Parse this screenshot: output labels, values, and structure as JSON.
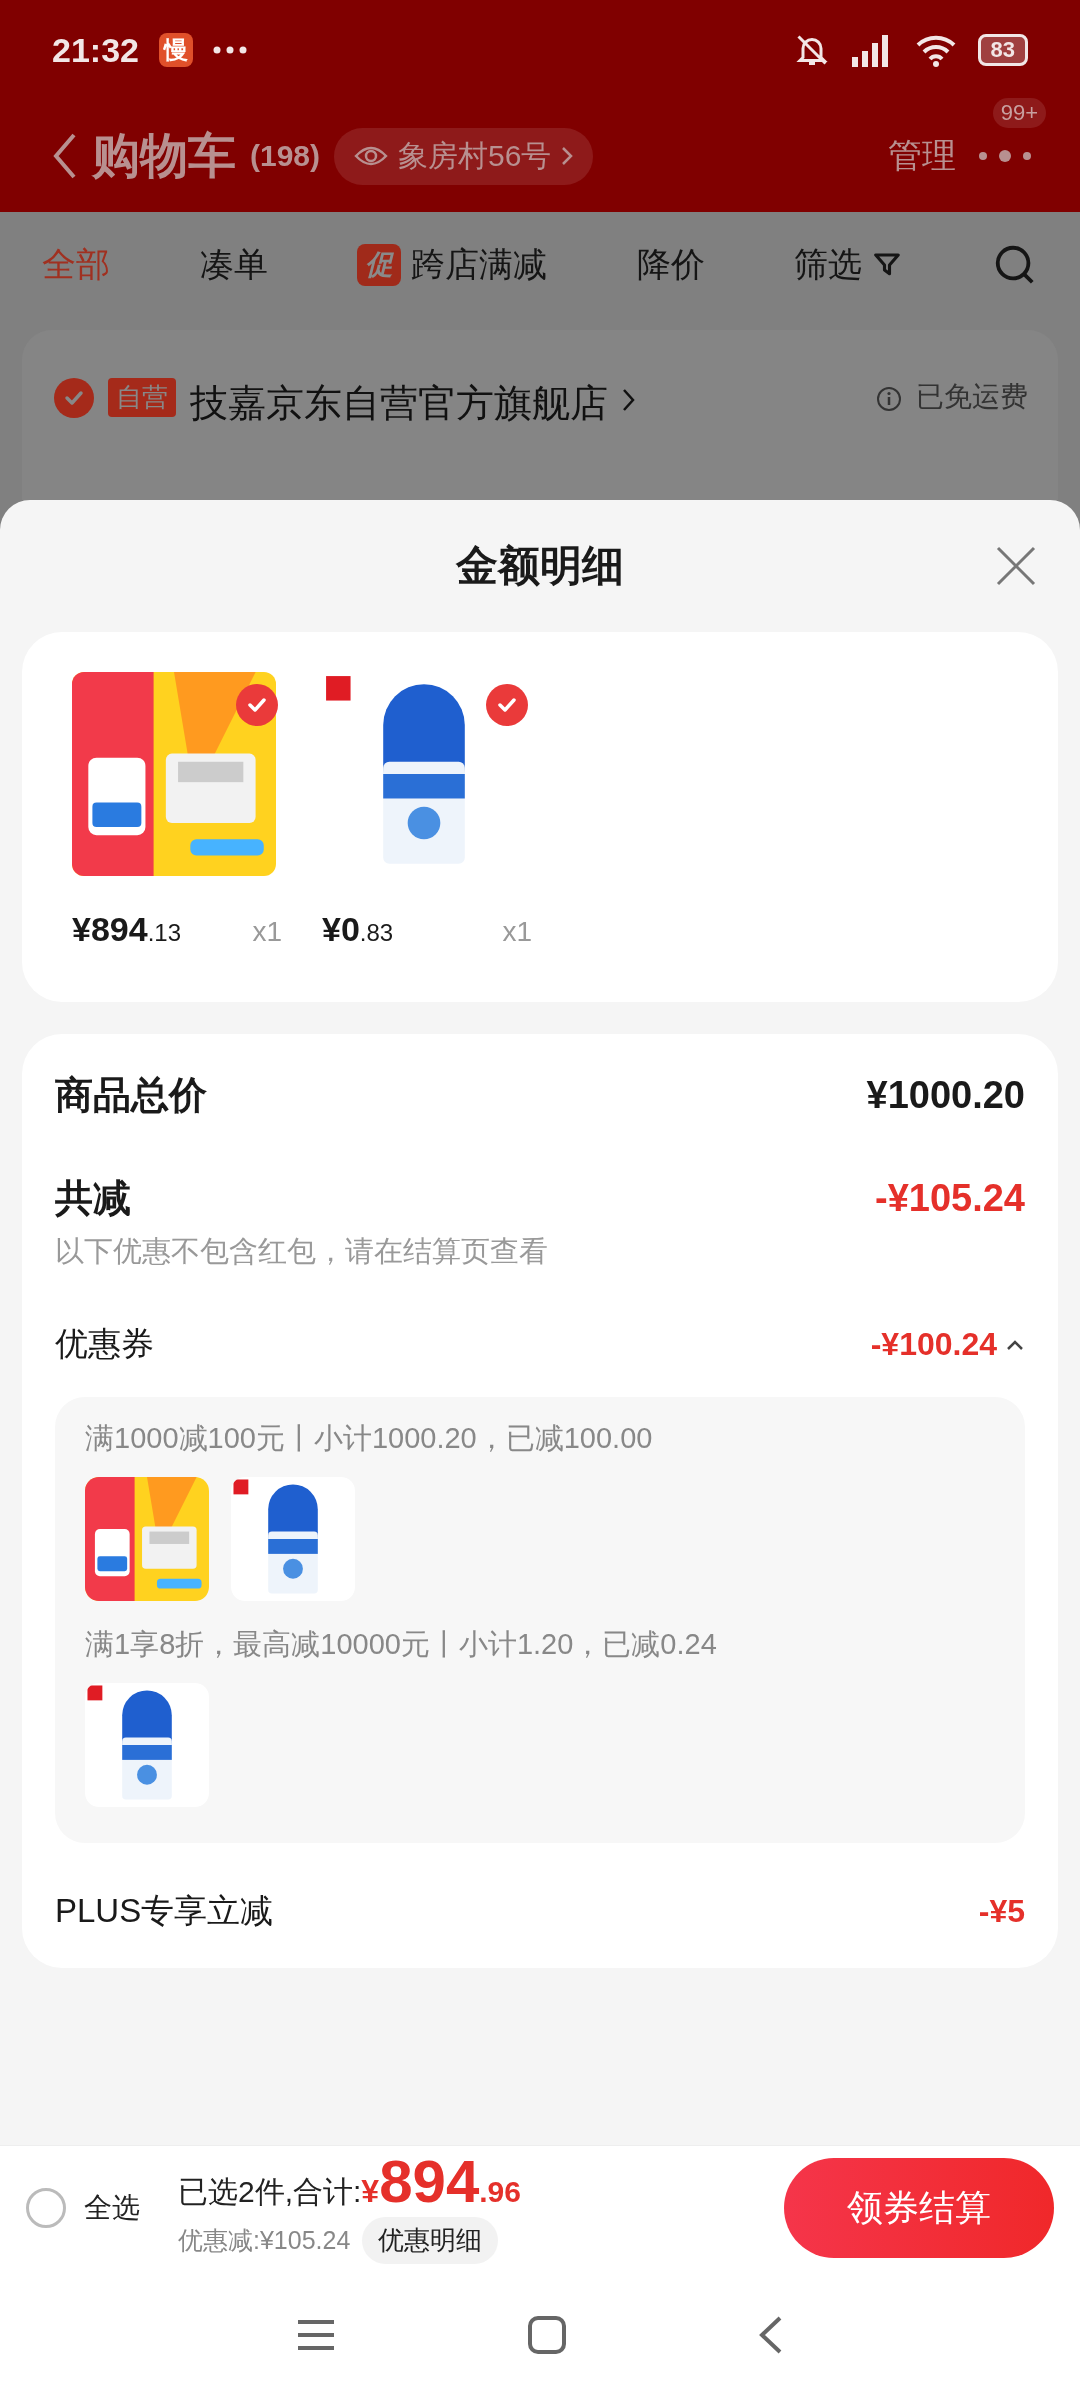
{
  "status_bar": {
    "time": "21:32",
    "app_badge": "慢",
    "battery": "83"
  },
  "header": {
    "title": "购物车",
    "count": "(198)",
    "location": "象房村56号",
    "manage": "管理",
    "badge": "99+"
  },
  "filter_tabs": [
    {
      "label": "全部",
      "selected": true
    },
    {
      "label": "凑单",
      "selected": false
    },
    {
      "label": "跨店满减",
      "selected": false,
      "tag": "促"
    },
    {
      "label": "降价",
      "selected": false
    },
    {
      "label": "筛选",
      "selected": false,
      "kind": "filter"
    }
  ],
  "store": {
    "checked": true,
    "tag": "自营",
    "name": "技嘉京东自营官方旗舰店",
    "shipping": "已免运费"
  },
  "sheet": {
    "title": "金额明细",
    "products": [
      {
        "kind": "picture",
        "checked": true,
        "price": "¥894",
        "price_decimal": ".13",
        "quantity": "x1"
      },
      {
        "kind": "picture",
        "checked": true,
        "price": "¥0",
        "price_decimal": ".83",
        "quantity": "x1"
      }
    ],
    "summary": {
      "total_label": "商品总价",
      "total": "¥1000.20",
      "discount_label": "共减",
      "discount": "-¥105.24",
      "note": "以下优惠不包含红包，请在结算页查看",
      "coupon": {
        "label": "优惠券",
        "amount": "-¥100.24",
        "expanded": true,
        "promotions": [
          {
            "text": "满1000减100元丨小计1000.20，已减100.00"
          },
          {
            "text": "满1享8折，最高减10000元丨小计1.20，已减0.24"
          }
        ]
      },
      "plus_label": "PLUS专享立减",
      "plus_amount": "-¥5"
    }
  },
  "bottom_bar": {
    "select_all": {
      "label": "全选",
      "checked": false
    },
    "selected_text": "已选2件,合计:",
    "currency": "¥",
    "total": "894",
    "total_decimal": ".96",
    "discount": "优惠减:¥105.24",
    "detail_button": "优惠明细",
    "checkout": "领券结算"
  }
}
